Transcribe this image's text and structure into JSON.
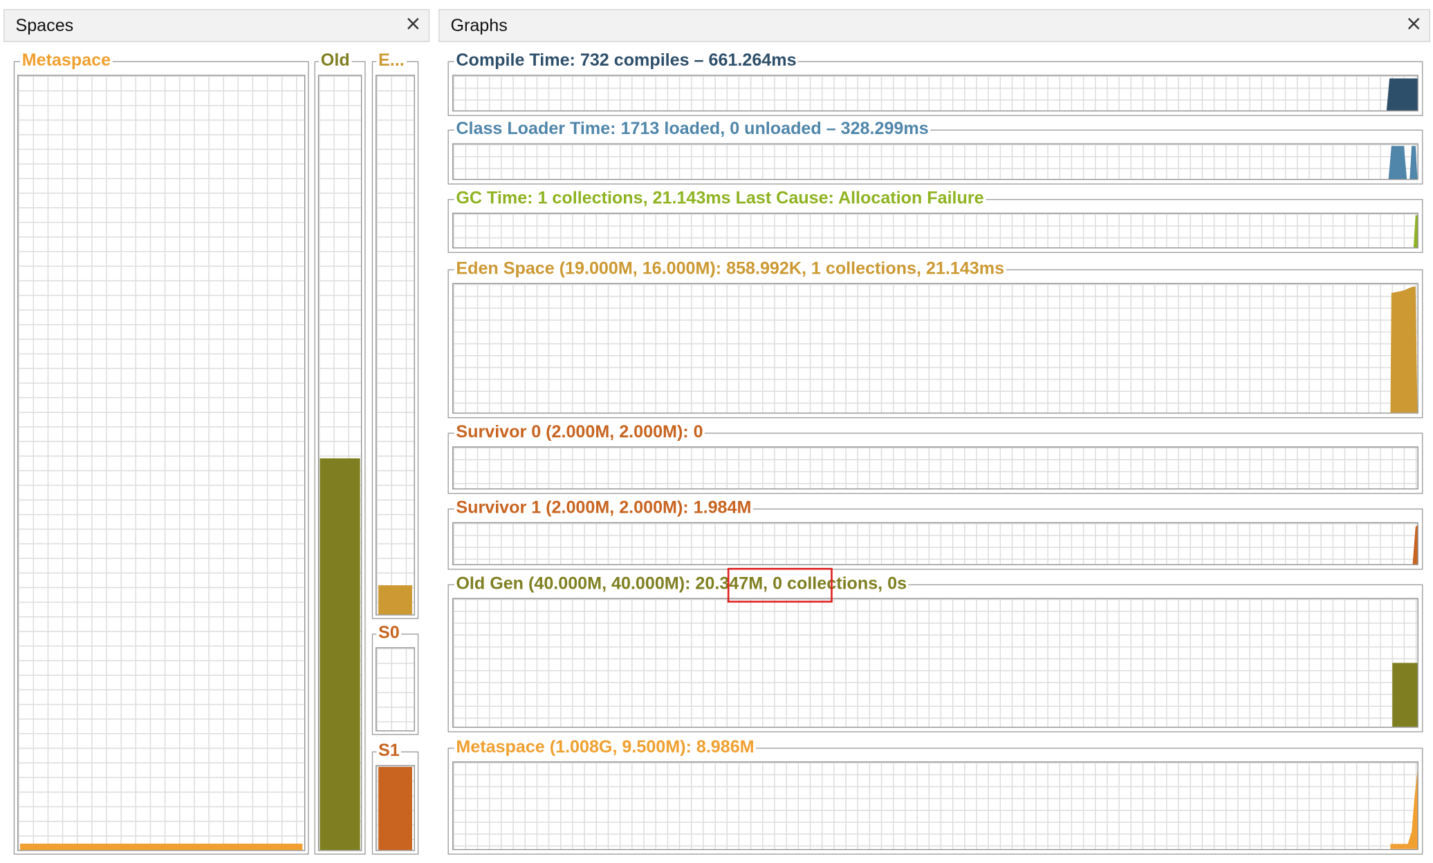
{
  "spaces_panel": {
    "title": "Spaces",
    "close_glyph": "×",
    "metaspace": {
      "label": "Metaspace",
      "color": "#f0a030",
      "fill_fraction": 0.008
    },
    "old": {
      "label": "Old",
      "color": "#7f7f22",
      "fill_fraction": 0.506
    },
    "eden": {
      "label": "E...",
      "color": "#cc9933",
      "fill_fraction": 0.054
    },
    "s0": {
      "label": "S0",
      "color": "#c86420",
      "fill_fraction": 0.0
    },
    "s1": {
      "label": "S1",
      "color": "#c86420",
      "fill_fraction": 0.992
    }
  },
  "graphs_panel": {
    "title": "Graphs",
    "close_glyph": "×",
    "graphs": [
      {
        "key": "compile",
        "label": "Compile Time: 732 compiles – 661.264ms",
        "color": "#2e4f6a"
      },
      {
        "key": "classloader",
        "label": "Class Loader Time: 1713 loaded, 0 unloaded – 328.299ms",
        "color": "#4f86aa"
      },
      {
        "key": "gc",
        "label": "GC Time: 1 collections, 21.143ms Last Cause: Allocation Failure",
        "color": "#8fb322"
      },
      {
        "key": "eden",
        "label": "Eden Space (19.000M, 16.000M): 858.992K, 1 collections, 21.143ms",
        "color": "#cc9933"
      },
      {
        "key": "s0",
        "label": "Survivor 0 (2.000M, 2.000M): 0",
        "color": "#c86420"
      },
      {
        "key": "s1",
        "label": "Survivor 1 (2.000M, 2.000M): 1.984M",
        "color": "#c86420"
      },
      {
        "key": "oldgen",
        "label_prefix": "Old Gen (40.000M, 40.000M): ",
        "label_highlight": "20.347M,",
        "label_suffix": " 0 collections, 0s",
        "color": "#7f7f22"
      },
      {
        "key": "meta",
        "label": "Metaspace (1.008G, 9.500M): 8.986M",
        "color": "#f0a030"
      }
    ]
  }
}
